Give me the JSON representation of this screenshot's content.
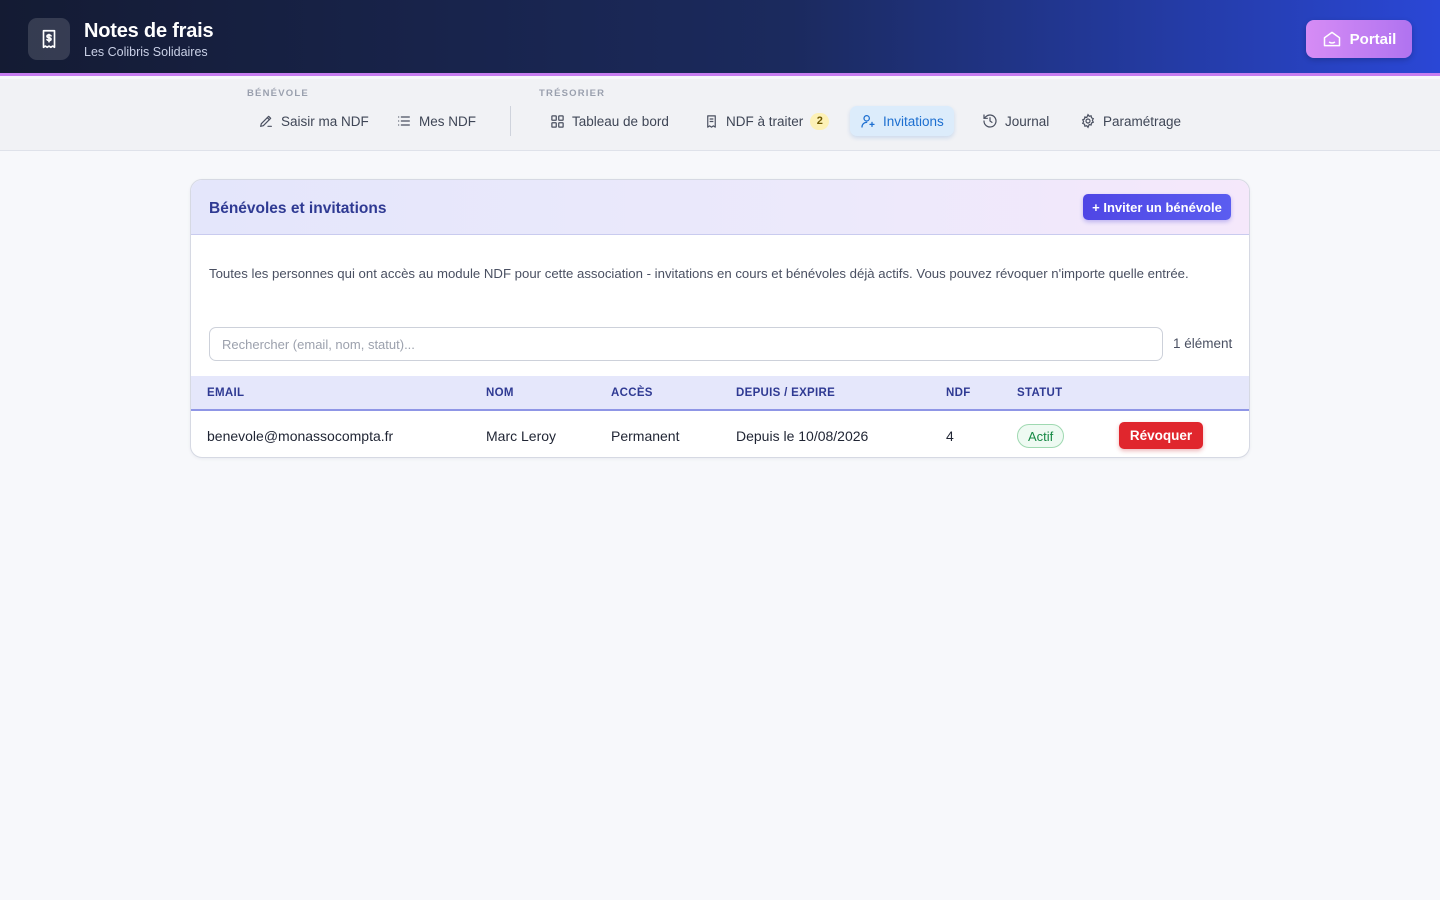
{
  "header": {
    "title": "Notes de frais",
    "subtitle": "Les Colibris Solidaires",
    "portal_label": "Portail"
  },
  "nav": {
    "groups": {
      "benevole": "BÉNÉVOLE",
      "tresorier": "TRÉSORIER"
    },
    "items": [
      {
        "label": "Saisir ma NDF",
        "icon": "pen-icon"
      },
      {
        "label": "Mes NDF",
        "icon": "list-icon"
      },
      {
        "label": "Tableau de bord",
        "icon": "dashboard-icon"
      },
      {
        "label": "NDF à traiter",
        "icon": "receipt-icon",
        "badge": "2"
      },
      {
        "label": "Invitations",
        "icon": "user-plus-icon",
        "active": true
      },
      {
        "label": "Journal",
        "icon": "history-icon"
      },
      {
        "label": "Paramétrage",
        "icon": "gear-icon"
      }
    ]
  },
  "card": {
    "title": "Bénévoles et invitations",
    "invite_label": "+ Inviter un bénévole",
    "intro": "Toutes les personnes qui ont accès au module NDF pour cette association - invitations en cours et bénévoles déjà actifs. Vous pouvez révoquer n'importe quelle entrée.",
    "search_placeholder": "Rechercher (email, nom, statut)...",
    "count": "1 élément"
  },
  "table": {
    "columns": [
      "EMAIL",
      "NOM",
      "ACCÈS",
      "DEPUIS / EXPIRE",
      "NDF",
      "STATUT"
    ],
    "rows": [
      {
        "email": "benevole@monassocompta.fr",
        "nom": "Marc Leroy",
        "acces": "Permanent",
        "depuis": "Depuis le 10/08/2026",
        "ndf": "4",
        "statut": "Actif",
        "action": "Révoquer"
      }
    ]
  },
  "colors": {
    "accent": "#4f46e5",
    "active_nav": "#1d6fd0",
    "danger": "#e0262d",
    "success": "#178a45"
  }
}
